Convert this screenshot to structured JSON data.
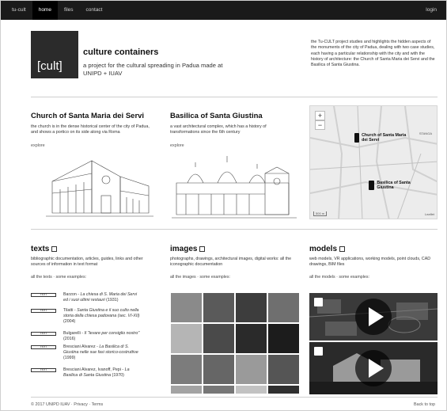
{
  "nav": {
    "items": [
      {
        "label": "tu-cult",
        "active": false
      },
      {
        "label": "home",
        "active": true
      },
      {
        "label": "files",
        "active": false
      },
      {
        "label": "contact",
        "active": false
      }
    ],
    "login": "login"
  },
  "header": {
    "logo_text": "[cult]",
    "title": "culture containers",
    "subtitle": "a project for the cultural spreading in Padua made at UNIPD + IUAV",
    "intro": "the Tu-CULT project studies and highlights the hidden aspects of the monuments of the city of Padua, dealing with two case studies, each having a particular relationship with the city and with the history of architecture: the Church of Santa Maria dei Servi and the Basilica of Santa Giustina."
  },
  "buildings": [
    {
      "title": "Church of Santa Maria dei Servi",
      "description": "the church is in the dense historical center of the city of Padua, and shows a portico on its side along via Roma",
      "link": "explore"
    },
    {
      "title": "Basilica of Santa Giustina",
      "description": "a vast architectural complex, which has a history of transformations since the 6th century",
      "link": "explore"
    }
  ],
  "map": {
    "zoom_in": "+",
    "zoom_out": "−",
    "markers": [
      {
        "label": "Church of Santa Maria dei Servi"
      },
      {
        "label": "Basilica of Santa Giustina"
      }
    ],
    "street_label": "STANGA",
    "scale": "500 m",
    "attribution": "Leaflet"
  },
  "sections": {
    "texts": {
      "title": "texts",
      "description": "bibliographic documentation, articles, guides, links and other sources of information in text format",
      "more": "all the texts · some examples:"
    },
    "images": {
      "title": "images",
      "description": "photographs, drawings, architectural images, digital works: all the iconographic documentation",
      "more": "all the images · some examples:"
    },
    "models": {
      "title": "models",
      "description": "web models, VR applications, working models, point clouds, CAD drawings, BIM files",
      "more": "all the models · some examples:"
    }
  },
  "texts_list": [
    {
      "badge": "TEXT",
      "author": "Barzon - ",
      "title": "La chiesa di S. Maria dei Servi ed i suoi ultimi restauri",
      "year": " (1931)"
    },
    {
      "badge": "TEXT",
      "author": "Tilatti - ",
      "title": "Santa Giustina e il suo culto nella storia della chiesa padovana (sec. VI-XII)",
      "year": " (2004)"
    },
    {
      "badge": "TEXT",
      "author": "Bulgarelli - ",
      "title": "Il \"levare per consiglio nostro\"",
      "year": " (2016)"
    },
    {
      "badge": "TEXT",
      "author": "Bresciani Alvarez - ",
      "title": "La Basilica di S. Giustina nelle sue fasi storico-costruttive",
      "year": " (1999)"
    },
    {
      "badge": "TEXT",
      "author": "Bresciani Alvarez, Ivanoff, Pepi - ",
      "title": "La Basilica di Santa Giustina",
      "year": " (1970)"
    }
  ],
  "image_tiles": [
    {
      "name": "photo-tile-1",
      "color": "#8a8a8a"
    },
    {
      "name": "photo-tile-2",
      "color": "#5a5a5a"
    },
    {
      "name": "photo-tile-3",
      "color": "#3d3d3d"
    },
    {
      "name": "photo-tile-4",
      "color": "#6f6f6f"
    },
    {
      "name": "photo-tile-5",
      "color": "#b5b5b5"
    },
    {
      "name": "photo-tile-6",
      "color": "#4a4a4a"
    },
    {
      "name": "photo-tile-7",
      "color": "#2a2a2a"
    },
    {
      "name": "photo-tile-8",
      "color": "#1c1c1c"
    },
    {
      "name": "photo-tile-9",
      "color": "#7c7c7c"
    },
    {
      "name": "photo-tile-10",
      "color": "#666666"
    },
    {
      "name": "photo-tile-11",
      "color": "#9a9a9a"
    },
    {
      "name": "photo-tile-12",
      "color": "#555555"
    },
    {
      "name": "photo-tile-13",
      "color": "#a3a3a3"
    },
    {
      "name": "photo-tile-14",
      "color": "#777777"
    },
    {
      "name": "photo-tile-15",
      "color": "#c2c2c2"
    },
    {
      "name": "photo-tile-16",
      "color": "#2f2f2f"
    }
  ],
  "footer": {
    "left": "© 2017 UNIPD IUAV · Privacy · Terms",
    "right": "Back to top"
  }
}
